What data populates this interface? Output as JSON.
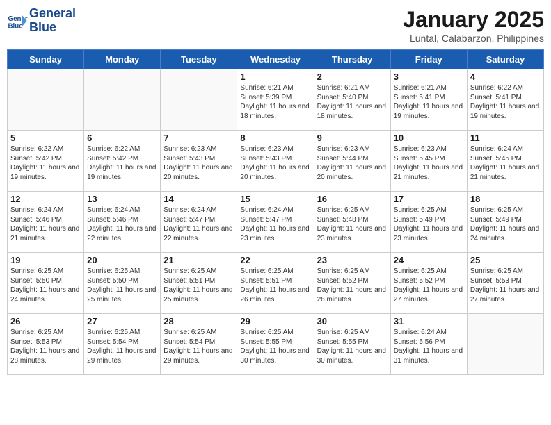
{
  "header": {
    "logo_line1": "General",
    "logo_line2": "Blue",
    "title": "January 2025",
    "subtitle": "Luntal, Calabarzon, Philippines"
  },
  "days_of_week": [
    "Sunday",
    "Monday",
    "Tuesday",
    "Wednesday",
    "Thursday",
    "Friday",
    "Saturday"
  ],
  "weeks": [
    [
      {
        "day": "",
        "info": ""
      },
      {
        "day": "",
        "info": ""
      },
      {
        "day": "",
        "info": ""
      },
      {
        "day": "1",
        "info": "Sunrise: 6:21 AM\nSunset: 5:39 PM\nDaylight: 11 hours and 18 minutes."
      },
      {
        "day": "2",
        "info": "Sunrise: 6:21 AM\nSunset: 5:40 PM\nDaylight: 11 hours and 18 minutes."
      },
      {
        "day": "3",
        "info": "Sunrise: 6:21 AM\nSunset: 5:41 PM\nDaylight: 11 hours and 19 minutes."
      },
      {
        "day": "4",
        "info": "Sunrise: 6:22 AM\nSunset: 5:41 PM\nDaylight: 11 hours and 19 minutes."
      }
    ],
    [
      {
        "day": "5",
        "info": "Sunrise: 6:22 AM\nSunset: 5:42 PM\nDaylight: 11 hours and 19 minutes."
      },
      {
        "day": "6",
        "info": "Sunrise: 6:22 AM\nSunset: 5:42 PM\nDaylight: 11 hours and 19 minutes."
      },
      {
        "day": "7",
        "info": "Sunrise: 6:23 AM\nSunset: 5:43 PM\nDaylight: 11 hours and 20 minutes."
      },
      {
        "day": "8",
        "info": "Sunrise: 6:23 AM\nSunset: 5:43 PM\nDaylight: 11 hours and 20 minutes."
      },
      {
        "day": "9",
        "info": "Sunrise: 6:23 AM\nSunset: 5:44 PM\nDaylight: 11 hours and 20 minutes."
      },
      {
        "day": "10",
        "info": "Sunrise: 6:23 AM\nSunset: 5:45 PM\nDaylight: 11 hours and 21 minutes."
      },
      {
        "day": "11",
        "info": "Sunrise: 6:24 AM\nSunset: 5:45 PM\nDaylight: 11 hours and 21 minutes."
      }
    ],
    [
      {
        "day": "12",
        "info": "Sunrise: 6:24 AM\nSunset: 5:46 PM\nDaylight: 11 hours and 21 minutes."
      },
      {
        "day": "13",
        "info": "Sunrise: 6:24 AM\nSunset: 5:46 PM\nDaylight: 11 hours and 22 minutes."
      },
      {
        "day": "14",
        "info": "Sunrise: 6:24 AM\nSunset: 5:47 PM\nDaylight: 11 hours and 22 minutes."
      },
      {
        "day": "15",
        "info": "Sunrise: 6:24 AM\nSunset: 5:47 PM\nDaylight: 11 hours and 23 minutes."
      },
      {
        "day": "16",
        "info": "Sunrise: 6:25 AM\nSunset: 5:48 PM\nDaylight: 11 hours and 23 minutes."
      },
      {
        "day": "17",
        "info": "Sunrise: 6:25 AM\nSunset: 5:49 PM\nDaylight: 11 hours and 23 minutes."
      },
      {
        "day": "18",
        "info": "Sunrise: 6:25 AM\nSunset: 5:49 PM\nDaylight: 11 hours and 24 minutes."
      }
    ],
    [
      {
        "day": "19",
        "info": "Sunrise: 6:25 AM\nSunset: 5:50 PM\nDaylight: 11 hours and 24 minutes."
      },
      {
        "day": "20",
        "info": "Sunrise: 6:25 AM\nSunset: 5:50 PM\nDaylight: 11 hours and 25 minutes."
      },
      {
        "day": "21",
        "info": "Sunrise: 6:25 AM\nSunset: 5:51 PM\nDaylight: 11 hours and 25 minutes."
      },
      {
        "day": "22",
        "info": "Sunrise: 6:25 AM\nSunset: 5:51 PM\nDaylight: 11 hours and 26 minutes."
      },
      {
        "day": "23",
        "info": "Sunrise: 6:25 AM\nSunset: 5:52 PM\nDaylight: 11 hours and 26 minutes."
      },
      {
        "day": "24",
        "info": "Sunrise: 6:25 AM\nSunset: 5:52 PM\nDaylight: 11 hours and 27 minutes."
      },
      {
        "day": "25",
        "info": "Sunrise: 6:25 AM\nSunset: 5:53 PM\nDaylight: 11 hours and 27 minutes."
      }
    ],
    [
      {
        "day": "26",
        "info": "Sunrise: 6:25 AM\nSunset: 5:53 PM\nDaylight: 11 hours and 28 minutes."
      },
      {
        "day": "27",
        "info": "Sunrise: 6:25 AM\nSunset: 5:54 PM\nDaylight: 11 hours and 29 minutes."
      },
      {
        "day": "28",
        "info": "Sunrise: 6:25 AM\nSunset: 5:54 PM\nDaylight: 11 hours and 29 minutes."
      },
      {
        "day": "29",
        "info": "Sunrise: 6:25 AM\nSunset: 5:55 PM\nDaylight: 11 hours and 30 minutes."
      },
      {
        "day": "30",
        "info": "Sunrise: 6:25 AM\nSunset: 5:55 PM\nDaylight: 11 hours and 30 minutes."
      },
      {
        "day": "31",
        "info": "Sunrise: 6:24 AM\nSunset: 5:56 PM\nDaylight: 11 hours and 31 minutes."
      },
      {
        "day": "",
        "info": ""
      }
    ]
  ]
}
